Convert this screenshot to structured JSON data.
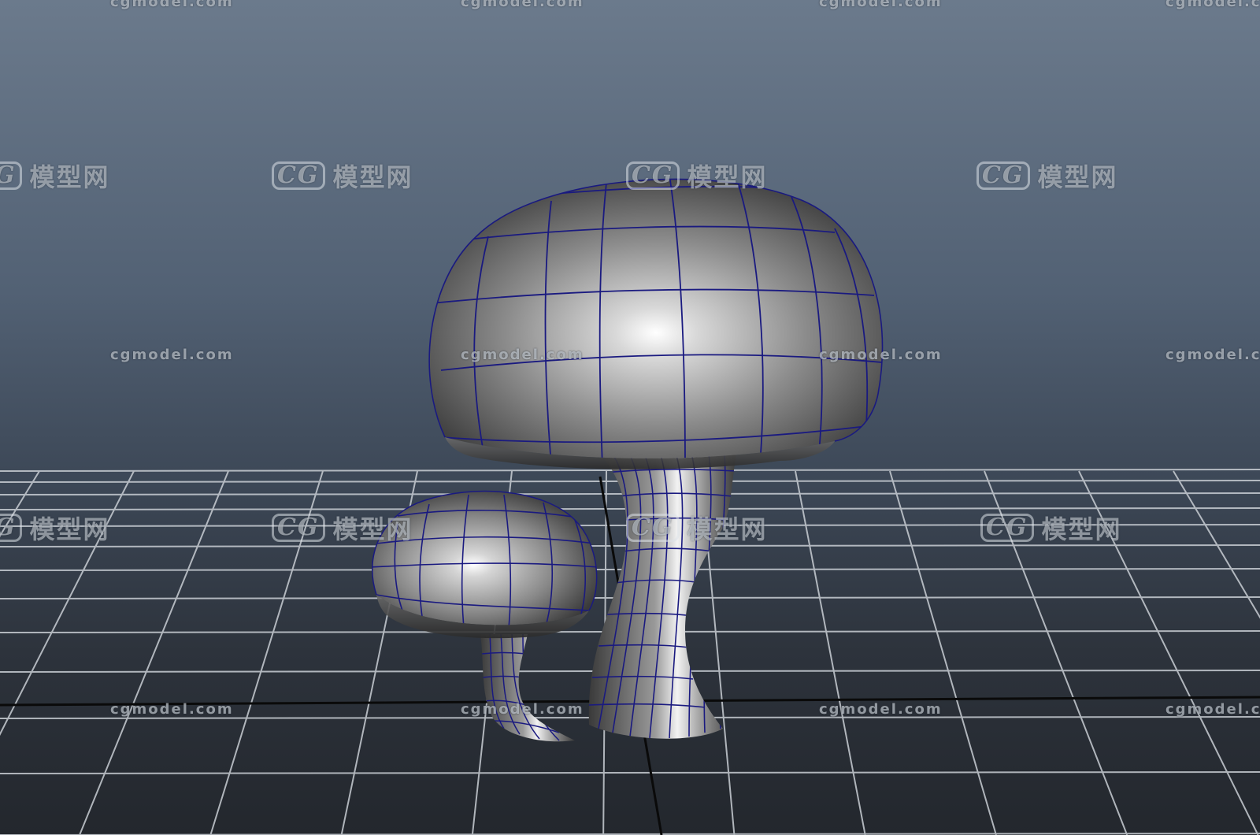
{
  "viewport": {
    "background_top": "#6b7a8c",
    "background_bottom": "#23272d",
    "grid_color": "#c9ced4",
    "axis_color": "#0a0a0a",
    "wireframe_color": "#1a1a80",
    "surface_color": "#8a8a8a"
  },
  "watermark": {
    "url_text": "cgmodel.com",
    "brand_text": "模型网",
    "logo_text": "CG"
  },
  "objects": [
    {
      "name": "large-mushroom"
    },
    {
      "name": "small-mushroom"
    }
  ]
}
